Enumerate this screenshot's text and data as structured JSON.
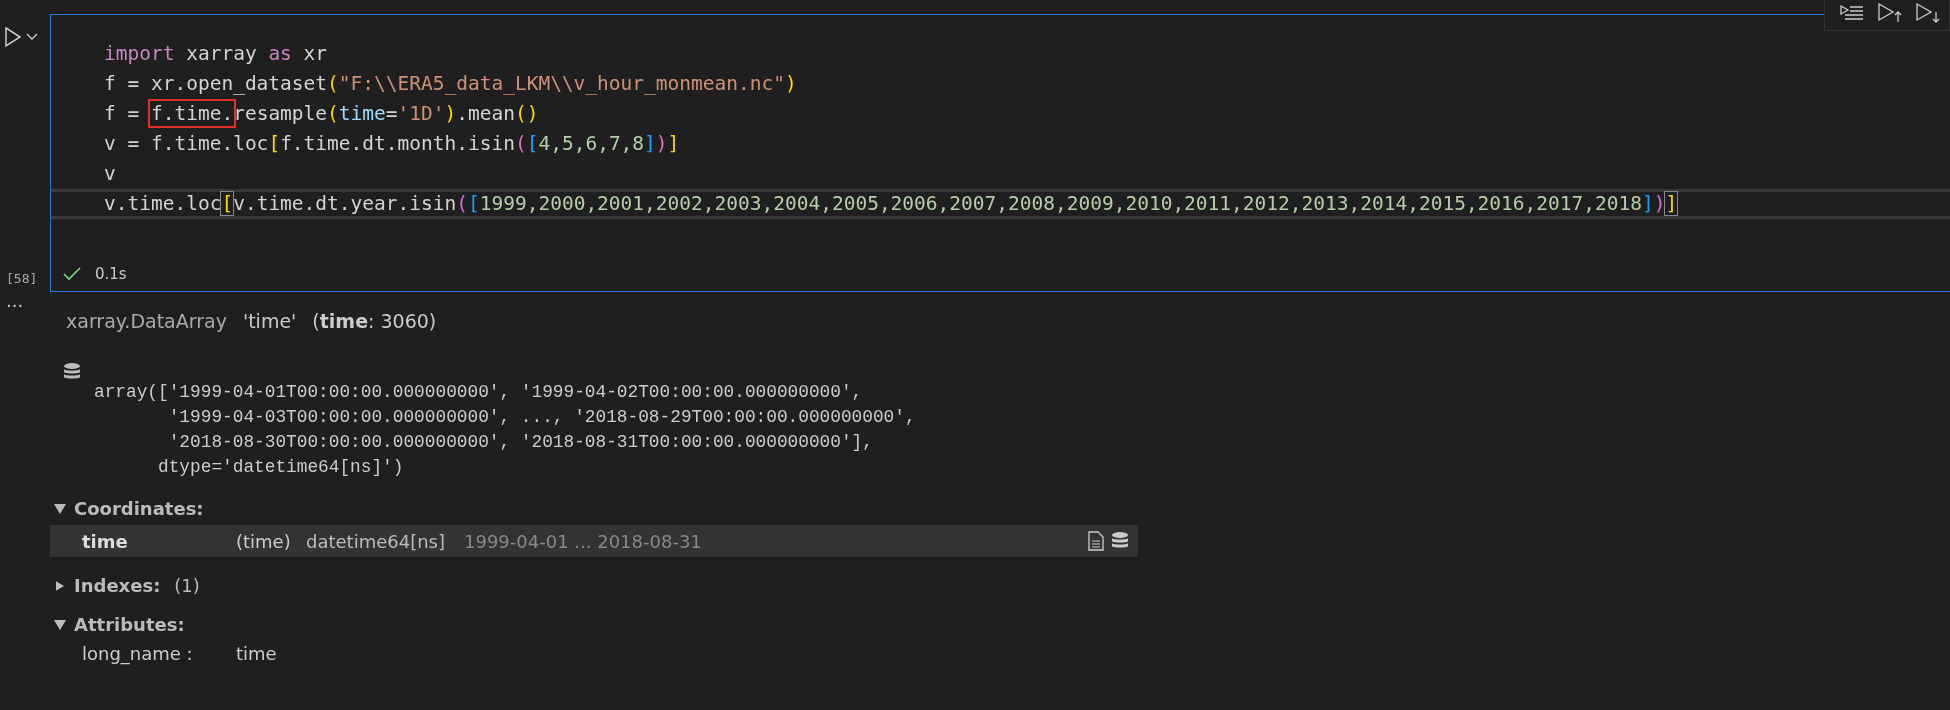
{
  "cell": {
    "execution_count": "[58]",
    "status": {
      "succeeded": true,
      "duration": "0.1s"
    },
    "lines": [
      {
        "current": false,
        "tokens": [
          {
            "text": "import",
            "kind": "keyword"
          },
          {
            "text": " xarray ",
            "kind": "plain"
          },
          {
            "text": "as",
            "kind": "keyword"
          },
          {
            "text": " xr",
            "kind": "plain"
          }
        ]
      },
      {
        "current": false,
        "tokens": [
          {
            "text": "f = xr.open_dataset",
            "kind": "plain"
          },
          {
            "text": "(",
            "kind": "bracket1"
          },
          {
            "text": "\"F:\\\\ERA5_data_LKM\\\\v_hour_monmean.nc\"",
            "kind": "string"
          },
          {
            "text": ")",
            "kind": "bracket1"
          }
        ]
      },
      {
        "current": false,
        "tokens": [
          {
            "text": "f = ",
            "kind": "plain"
          },
          {
            "text": "f.time.",
            "kind": "plain",
            "annotated": true
          },
          {
            "text": "resample",
            "kind": "plain"
          },
          {
            "text": "(",
            "kind": "bracket1"
          },
          {
            "text": "time",
            "kind": "param"
          },
          {
            "text": "=",
            "kind": "plain"
          },
          {
            "text": "'1D'",
            "kind": "string"
          },
          {
            "text": ")",
            "kind": "bracket1"
          },
          {
            "text": ".mean",
            "kind": "plain"
          },
          {
            "text": "()",
            "kind": "bracket1"
          }
        ]
      },
      {
        "current": false,
        "tokens": [
          {
            "text": "v = f.time.loc",
            "kind": "plain"
          },
          {
            "text": "[",
            "kind": "bracket1"
          },
          {
            "text": "f.time.dt.month.isin",
            "kind": "plain"
          },
          {
            "text": "(",
            "kind": "bracket2"
          },
          {
            "text": "[",
            "kind": "bracket3"
          },
          {
            "text": "4,5,6,7,8",
            "kind": "number"
          },
          {
            "text": "]",
            "kind": "bracket3"
          },
          {
            "text": ")",
            "kind": "bracket2"
          },
          {
            "text": "]",
            "kind": "bracket1"
          }
        ]
      },
      {
        "current": false,
        "tokens": [
          {
            "text": "v",
            "kind": "plain"
          }
        ]
      },
      {
        "current": true,
        "tokens": [
          {
            "text": "v.time.loc",
            "kind": "plain"
          },
          {
            "text": "[",
            "kind": "bracket1",
            "matched": true
          },
          {
            "text": "v.time.dt.year.isin",
            "kind": "plain"
          },
          {
            "text": "(",
            "kind": "bracket2"
          },
          {
            "text": "[",
            "kind": "bracket3"
          },
          {
            "text": "1999,2000,2001,2002,2003,2004,2005,2006,2007,2008,2009,2010,2011,2012,2013,2014,2015,2016,2017,2018",
            "kind": "number"
          },
          {
            "text": "]",
            "kind": "bracket3"
          },
          {
            "text": ")",
            "kind": "bracket2"
          },
          {
            "text": "]",
            "kind": "bracket1",
            "matched": true
          }
        ]
      }
    ]
  },
  "output": {
    "more": "...",
    "header": {
      "type": "xarray.DataArray",
      "name": "'time'",
      "dims": "(**time**: 3060)"
    },
    "array_lines": [
      "array(['1999-04-01T00:00:00.000000000', '1999-04-02T00:00:00.000000000',",
      "       '1999-04-03T00:00:00.000000000', ..., '2018-08-29T00:00:00.000000000',",
      "       '2018-08-30T00:00:00.000000000', '2018-08-31T00:00:00.000000000'],",
      "      dtype='datetime64[ns]')"
    ],
    "sections": [
      {
        "title": "Coordinates:",
        "expanded": true,
        "rows": [
          {
            "name": "time",
            "dims": "(time)",
            "dtype": "datetime64[ns]",
            "preview": "1999-04-01 ... 2018-08-31"
          }
        ]
      },
      {
        "title": "Indexes:",
        "count": "(1)",
        "expanded": false
      },
      {
        "title": "Attributes:",
        "expanded": true,
        "attrs": [
          {
            "key": "long_name :",
            "value": "time"
          }
        ]
      }
    ]
  }
}
